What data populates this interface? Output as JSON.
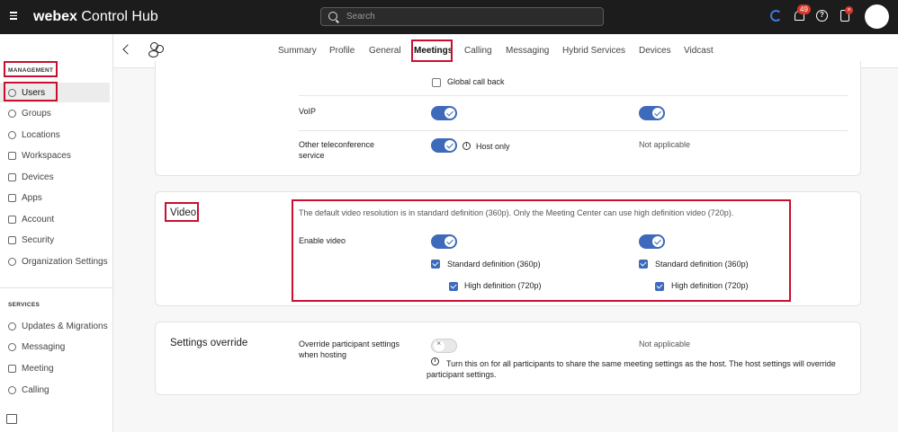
{
  "app": {
    "brand_bold": "webex",
    "brand_rest": "Control Hub"
  },
  "search": {
    "placeholder": "Search"
  },
  "header": {
    "notification_count": "49",
    "help_symbol": "?",
    "task_badge": "×"
  },
  "sidebar": {
    "management_label": "MANAGEMENT",
    "management_items": [
      {
        "label": "Users",
        "icon": "user-icon"
      },
      {
        "label": "Groups",
        "icon": "groups-icon"
      },
      {
        "label": "Locations",
        "icon": "location-pin-icon"
      },
      {
        "label": "Workspaces",
        "icon": "workspaces-icon"
      },
      {
        "label": "Devices",
        "icon": "devices-icon"
      },
      {
        "label": "Apps",
        "icon": "apps-icon"
      },
      {
        "label": "Account",
        "icon": "account-icon"
      },
      {
        "label": "Security",
        "icon": "shield-icon"
      },
      {
        "label": "Organization Settings",
        "icon": "gear-icon"
      }
    ],
    "services_label": "SERVICES",
    "services_items": [
      {
        "label": "Updates & Migrations",
        "icon": "refresh-icon"
      },
      {
        "label": "Messaging",
        "icon": "chat-icon"
      },
      {
        "label": "Meeting",
        "icon": "calendar-icon"
      },
      {
        "label": "Calling",
        "icon": "phone-icon"
      }
    ]
  },
  "tabs": [
    "Summary",
    "Profile",
    "General",
    "Meetings",
    "Calling",
    "Messaging",
    "Hybrid Services",
    "Devices",
    "Vidcast"
  ],
  "active_tab": "Meetings",
  "audio_card": {
    "global_call_back": "Global call back",
    "voip_label": "VoIP",
    "other_service_label": "Other teleconference service",
    "host_only": "Host only",
    "not_applicable": "Not applicable"
  },
  "video_card": {
    "title": "Video",
    "description": "The default video resolution is in standard definition (360p). Only the Meeting Center can use high definition video (720p).",
    "enable_label": "Enable video",
    "standard_def": "Standard definition (360p)",
    "high_def": "High definition (720p)"
  },
  "override_card": {
    "title": "Settings override",
    "label": "Override participant settings when hosting",
    "not_applicable": "Not applicable",
    "info_text": "Turn this on for all participants to share the same meeting settings as the host. The host settings will override participant settings."
  },
  "colors": {
    "accent": "#3d6aba",
    "highlight": "#c8102e",
    "topbar": "#1c1c1c"
  }
}
